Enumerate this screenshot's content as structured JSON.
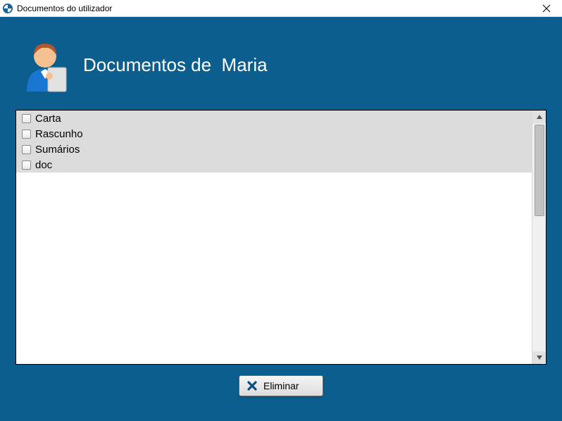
{
  "window": {
    "title": "Documentos do utilizador"
  },
  "header": {
    "title": "Documentos de  Maria"
  },
  "documents": [
    {
      "label": "Carta",
      "checked": false
    },
    {
      "label": "Rascunho",
      "checked": false
    },
    {
      "label": "Sumários",
      "checked": false
    },
    {
      "label": "doc",
      "checked": false
    }
  ],
  "buttons": {
    "delete_label": "Eliminar"
  }
}
